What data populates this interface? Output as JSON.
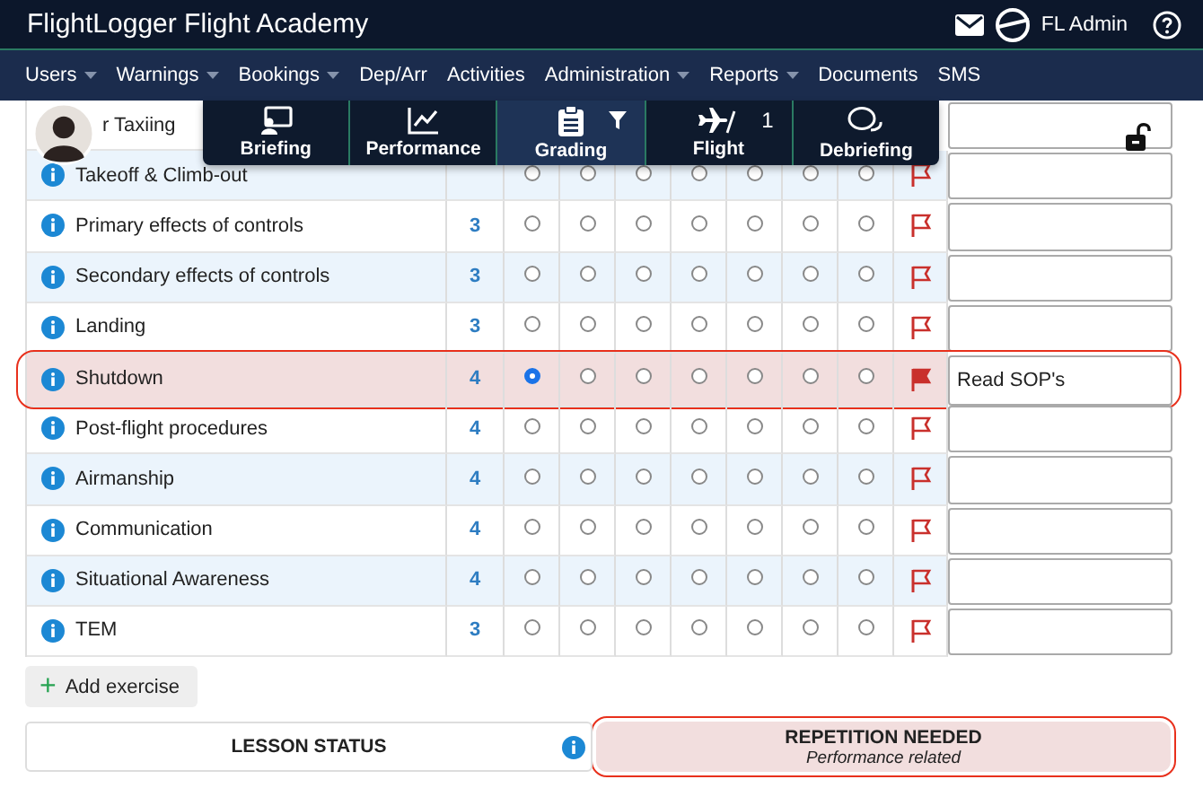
{
  "header": {
    "title": "FlightLogger Flight Academy",
    "user": "FL Admin"
  },
  "nav": [
    {
      "label": "Users",
      "dropdown": true
    },
    {
      "label": "Warnings",
      "dropdown": true
    },
    {
      "label": "Bookings",
      "dropdown": true
    },
    {
      "label": "Dep/Arr",
      "dropdown": false
    },
    {
      "label": "Activities",
      "dropdown": false
    },
    {
      "label": "Administration",
      "dropdown": true
    },
    {
      "label": "Reports",
      "dropdown": true
    },
    {
      "label": "Documents",
      "dropdown": false
    },
    {
      "label": "SMS",
      "dropdown": false
    }
  ],
  "tabs": [
    {
      "label": "Briefing",
      "selected": false,
      "filter": false
    },
    {
      "label": "Performance",
      "selected": false,
      "filter": false
    },
    {
      "label": "Grading",
      "selected": true,
      "filter": true
    },
    {
      "label": "Flight",
      "selected": false,
      "filter": false,
      "count": "1"
    },
    {
      "label": "Debriefing",
      "selected": false,
      "filter": false
    }
  ],
  "rows": [
    {
      "label": "r Taxiing",
      "covered": true,
      "selected": false,
      "comment": ""
    },
    {
      "label": "Takeoff & Climb-out",
      "flagged": false,
      "selected": false,
      "comment": "",
      "options": [
        {
          "selected": false
        },
        {
          "selected": false
        },
        {
          "selected": false
        },
        {
          "selected": false
        },
        {
          "selected": false
        },
        {
          "selected": false
        },
        {
          "selected": false
        }
      ]
    },
    {
      "label": "Primary effects of controls",
      "level": "3",
      "flagged": false,
      "selected": false,
      "comment": "",
      "options": [
        {
          "selected": false
        },
        {
          "selected": false
        },
        {
          "selected": false
        },
        {
          "selected": false
        },
        {
          "selected": false
        },
        {
          "selected": false
        },
        {
          "selected": false
        }
      ]
    },
    {
      "label": "Secondary effects of controls",
      "level": "3",
      "flagged": false,
      "selected": false,
      "comment": "",
      "options": [
        {
          "selected": false
        },
        {
          "selected": false
        },
        {
          "selected": false
        },
        {
          "selected": false
        },
        {
          "selected": false
        },
        {
          "selected": false
        },
        {
          "selected": false
        }
      ]
    },
    {
      "label": "Landing",
      "level": "3",
      "flagged": false,
      "selected": false,
      "comment": "",
      "options": [
        {
          "selected": false
        },
        {
          "selected": false
        },
        {
          "selected": false
        },
        {
          "selected": false
        },
        {
          "selected": false
        },
        {
          "selected": false
        },
        {
          "selected": false
        }
      ]
    },
    {
      "label": "Shutdown",
      "level": "4",
      "flagged": true,
      "selected": true,
      "comment": "Read SOP's",
      "options": [
        {
          "selected": true
        },
        {
          "selected": false
        },
        {
          "selected": false
        },
        {
          "selected": false
        },
        {
          "selected": false
        },
        {
          "selected": false
        },
        {
          "selected": false
        }
      ]
    },
    {
      "label": "Post-flight procedures",
      "level": "4",
      "flagged": false,
      "selected": false,
      "comment": "",
      "options": [
        {
          "selected": false
        },
        {
          "selected": false
        },
        {
          "selected": false
        },
        {
          "selected": false
        },
        {
          "selected": false
        },
        {
          "selected": false
        },
        {
          "selected": false
        }
      ]
    },
    {
      "label": "Airmanship",
      "level": "4",
      "flagged": false,
      "selected": false,
      "comment": "",
      "options": [
        {
          "selected": false
        },
        {
          "selected": false
        },
        {
          "selected": false
        },
        {
          "selected": false
        },
        {
          "selected": false
        },
        {
          "selected": false
        },
        {
          "selected": false
        }
      ]
    },
    {
      "label": "Communication",
      "level": "4",
      "flagged": false,
      "selected": false,
      "comment": "",
      "options": [
        {
          "selected": false
        },
        {
          "selected": false
        },
        {
          "selected": false
        },
        {
          "selected": false
        },
        {
          "selected": false
        },
        {
          "selected": false
        },
        {
          "selected": false
        }
      ]
    },
    {
      "label": "Situational Awareness",
      "level": "4",
      "flagged": false,
      "selected": false,
      "comment": "",
      "options": [
        {
          "selected": false
        },
        {
          "selected": false
        },
        {
          "selected": false
        },
        {
          "selected": false
        },
        {
          "selected": false
        },
        {
          "selected": false
        },
        {
          "selected": false
        }
      ]
    },
    {
      "label": "TEM",
      "level": "3",
      "flagged": false,
      "selected": false,
      "comment": "",
      "options": [
        {
          "selected": false
        },
        {
          "selected": false
        },
        {
          "selected": false
        },
        {
          "selected": false
        },
        {
          "selected": false
        },
        {
          "selected": false
        },
        {
          "selected": false
        }
      ]
    }
  ],
  "add_button": {
    "symbol": "+",
    "label": "Add exercise"
  },
  "lesson_status": {
    "label": "LESSON STATUS",
    "status": "REPETITION NEEDED",
    "note": "Performance related",
    "highlighted": true
  }
}
